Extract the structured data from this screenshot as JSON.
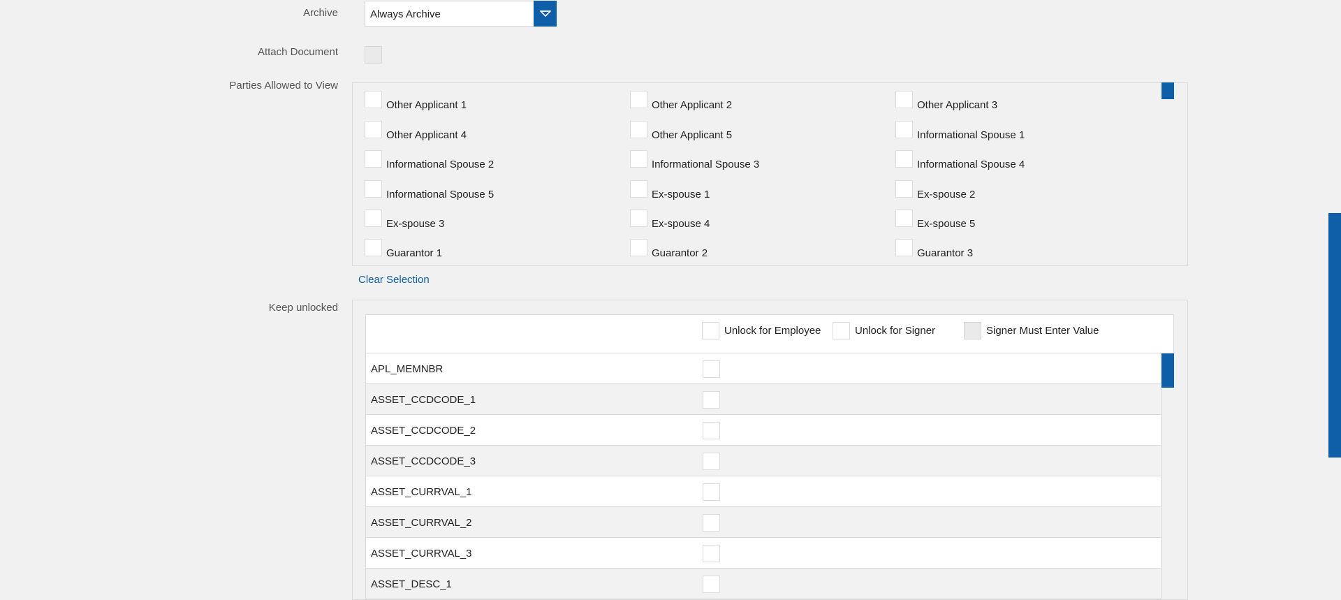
{
  "archive": {
    "label": "Archive",
    "selected": "Always Archive"
  },
  "attach_document": {
    "label": "Attach Document"
  },
  "parties": {
    "label": "Parties Allowed to View",
    "items": [
      "Other Applicant 1",
      "Other Applicant 2",
      "Other Applicant 3",
      "Other Applicant 4",
      "Other Applicant 5",
      "Informational Spouse 1",
      "Informational Spouse 2",
      "Informational Spouse 3",
      "Informational Spouse 4",
      "Informational Spouse 5",
      "Ex-spouse 1",
      "Ex-spouse 2",
      "Ex-spouse 3",
      "Ex-spouse 4",
      "Ex-spouse 5",
      "Guarantor 1",
      "Guarantor 2",
      "Guarantor 3"
    ],
    "clear_label": "Clear Selection"
  },
  "keep_unlocked": {
    "label": "Keep unlocked",
    "headers": {
      "employee": "Unlock for Employee",
      "signer": "Unlock for Signer",
      "must_enter": "Signer Must Enter Value"
    },
    "rows": [
      "APL_MEMNBR",
      "ASSET_CCDCODE_1",
      "ASSET_CCDCODE_2",
      "ASSET_CCDCODE_3",
      "ASSET_CURRVAL_1",
      "ASSET_CURRVAL_2",
      "ASSET_CURRVAL_3",
      "ASSET_DESC_1"
    ]
  },
  "colors": {
    "accent": "#0e5ea8",
    "background": "#f1f1f1"
  },
  "icons": {
    "dropdown": "chevron-down-icon"
  }
}
